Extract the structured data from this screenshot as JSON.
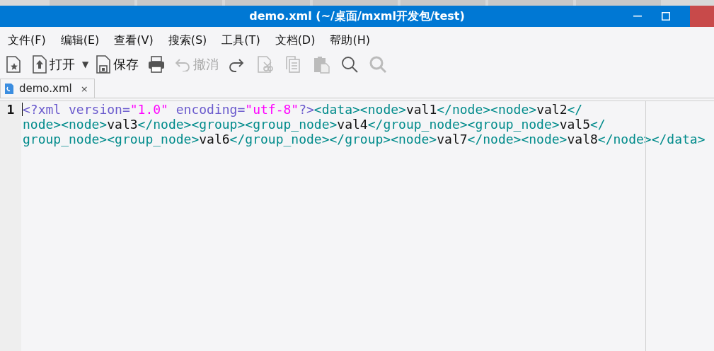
{
  "window": {
    "title": "demo.xml (~/桌面/mxml开发包/test)"
  },
  "menu": [
    "文件(F)",
    "编辑(E)",
    "查看(V)",
    "搜索(S)",
    "工具(T)",
    "文档(D)",
    "帮助(H)"
  ],
  "toolbar": [
    {
      "kind": "new",
      "disabled": false
    },
    {
      "kind": "open",
      "label": "打开",
      "disabled": false
    },
    {
      "kind": "dropdown",
      "label": "▼",
      "disabled": false
    },
    {
      "kind": "save",
      "label": "保存",
      "disabled": false
    },
    {
      "kind": "print",
      "disabled": false
    },
    {
      "kind": "undo",
      "label": "撤消",
      "disabled": true
    },
    {
      "kind": "redo",
      "disabled": false
    },
    {
      "kind": "cut",
      "disabled": true
    },
    {
      "kind": "copy",
      "disabled": true
    },
    {
      "kind": "paste",
      "disabled": true
    },
    {
      "kind": "find",
      "disabled": false
    },
    {
      "kind": "find-next",
      "disabled": true
    }
  ],
  "tabs": [
    {
      "label": "demo.xml",
      "close": "×",
      "selected": true
    }
  ],
  "editor": {
    "line_numbers": [
      "1"
    ],
    "lines": [
      [
        {
          "kind": "pi",
          "text": "<?xml "
        },
        {
          "kind": "attr",
          "text": "version="
        },
        {
          "kind": "string",
          "text": "\"1.0\""
        },
        {
          "kind": "attr",
          "text": " encoding="
        },
        {
          "kind": "string",
          "text": "\"utf-8\""
        },
        {
          "kind": "pi",
          "text": "?>"
        },
        {
          "kind": "tag",
          "text": "<data><node>"
        },
        {
          "kind": "text",
          "text": "val1"
        },
        {
          "kind": "tag",
          "text": "</node><node>"
        },
        {
          "kind": "text",
          "text": "val2"
        },
        {
          "kind": "tag",
          "text": "</"
        }
      ],
      [
        {
          "kind": "tag",
          "text": "node><node>"
        },
        {
          "kind": "text",
          "text": "val3"
        },
        {
          "kind": "tag",
          "text": "</node><group><group_node>"
        },
        {
          "kind": "text",
          "text": "val4"
        },
        {
          "kind": "tag",
          "text": "</group_node><group_node>"
        },
        {
          "kind": "text",
          "text": "val5"
        },
        {
          "kind": "tag",
          "text": "</"
        }
      ],
      [
        {
          "kind": "tag",
          "text": "group_node><group_node>"
        },
        {
          "kind": "text",
          "text": "val6"
        },
        {
          "kind": "tag",
          "text": "</group_node></group><node>"
        },
        {
          "kind": "text",
          "text": "val7"
        },
        {
          "kind": "tag",
          "text": "</node><node>"
        },
        {
          "kind": "text",
          "text": "val8"
        },
        {
          "kind": "tag",
          "text": "</node></data>"
        }
      ]
    ]
  }
}
